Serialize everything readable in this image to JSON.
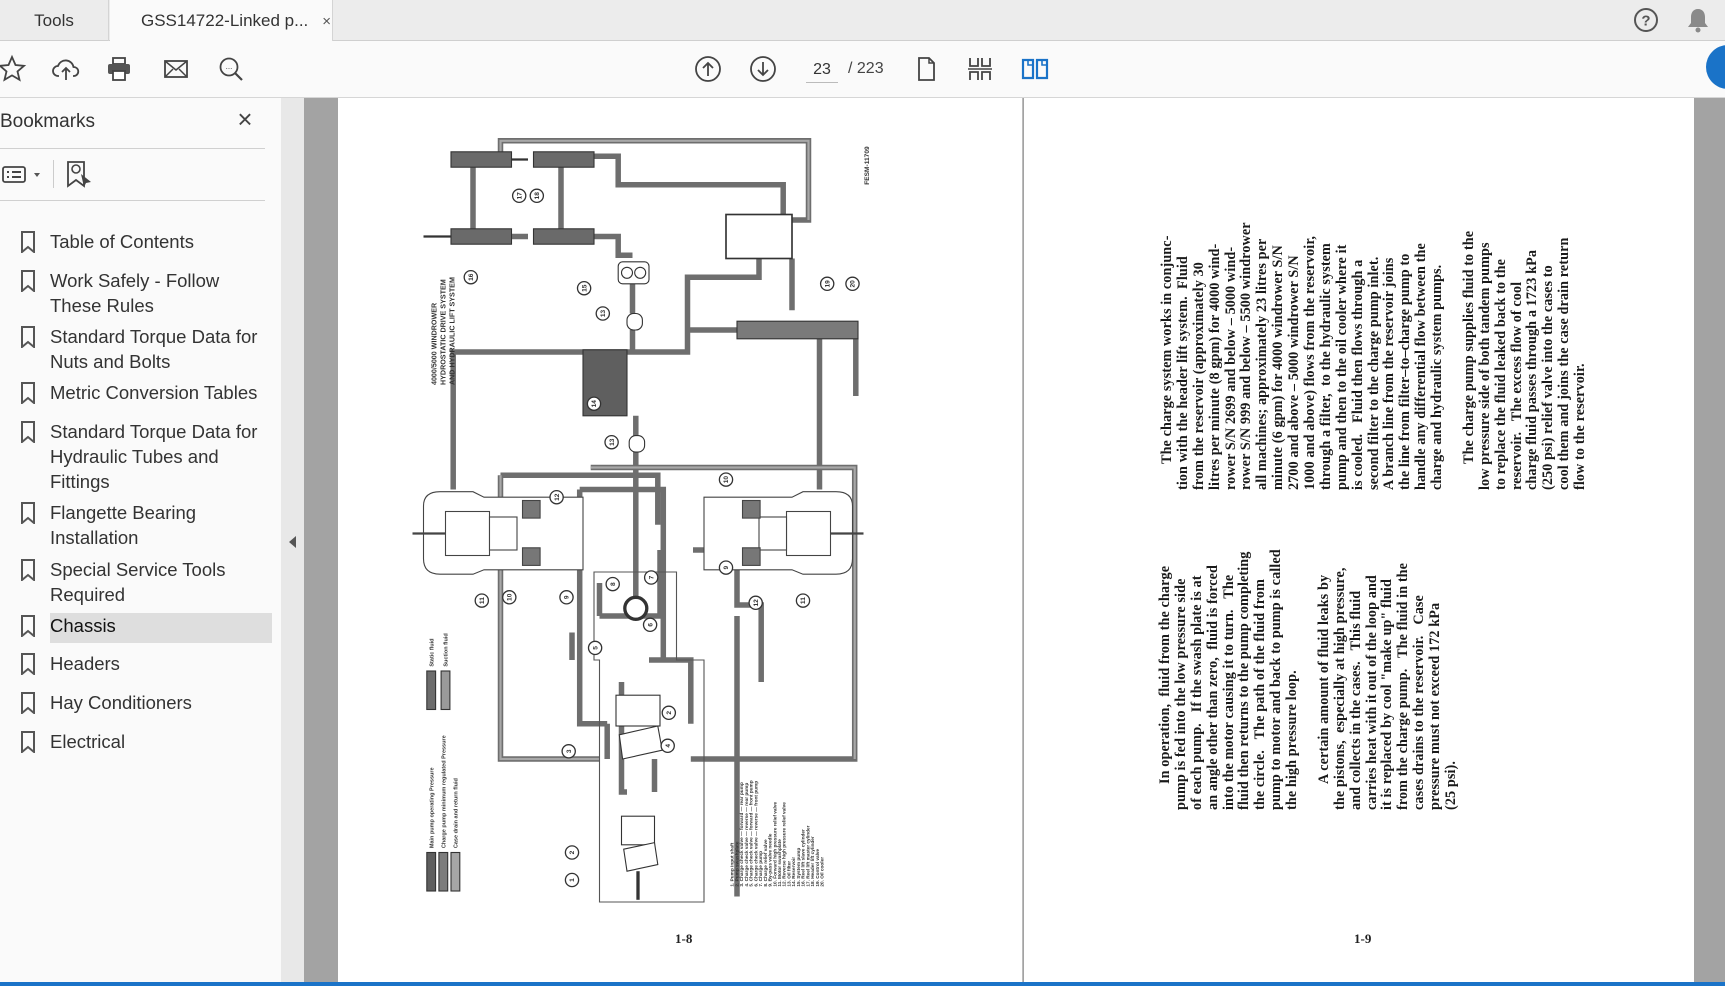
{
  "tabs": {
    "tools": "Tools",
    "document": "GSS14722-Linked p...",
    "close": "×"
  },
  "toolbar": {
    "current_page": "23",
    "total_pages": "/ 223",
    "icons": [
      "star-icon",
      "cloud-upload-icon",
      "print-icon",
      "mail-icon",
      "zoom-search-icon",
      "page-up-icon",
      "page-down-icon",
      "single-page-icon",
      "scroll-mode-icon",
      "two-page-icon",
      "help-icon",
      "bell-icon"
    ]
  },
  "accent": "#1a73c8",
  "sidebar": {
    "title": "Bookmarks",
    "close": "×",
    "items": [
      {
        "label": "Table of Contents"
      },
      {
        "label": "Work Safely - Follow These Rules"
      },
      {
        "label": "Standard Torque Data for Nuts and Bolts"
      },
      {
        "label": "Metric Conversion Tables"
      },
      {
        "label": "Standard Torque Data for Hydraulic Tubes and Fittings"
      },
      {
        "label": "Flangette Bearing Installation"
      },
      {
        "label": "Special Service Tools Required"
      },
      {
        "label": "Chassis",
        "active": true
      },
      {
        "label": "Headers"
      },
      {
        "label": "Hay Conditioners"
      },
      {
        "label": "Electrical"
      }
    ]
  },
  "diagram": {
    "title": [
      "4000/5000 WINDROWER",
      "HYDROSTATIC DRIVE SYSTEM",
      "AND HYDRAULIC LIFT SYSTEM"
    ],
    "figure_id": "FESM-11709",
    "legend_top": [
      "Static fluid",
      "Suction fluid"
    ],
    "legend_bottom": [
      "Main pump operating Pressure",
      "Charge pump minimum regulated Pressure",
      "Case drain and return fluid"
    ],
    "parts": [
      "1. Pump input shaft",
      "2. Pump swashplate",
      "3. Charge check valve — forward — rear pump",
      "4. Charge check valve — reverse — rear pump",
      "5. Charge check valve — forward — front pump",
      "6. Charge check valve — reverse — front pump",
      "7. Charge pump",
      "8. Charge relief valve",
      "9. By-pass valve needle",
      "10. Forward high pressure relief valve",
      "11. Motor swashplate",
      "12. Reverse high pressure relief valve",
      "13. Oil filter",
      "14. Reservoir",
      "15. System pump",
      "16. Reel lift slave cylinder",
      "17. Reel lift master cylinder",
      "18. Header lift cylinder",
      "19. Control valve",
      "20. Oil cooler"
    ],
    "callouts": [
      "17",
      "18",
      "16",
      "15",
      "19",
      "20",
      "13",
      "14",
      "13",
      "12",
      "10",
      "11",
      "10",
      "9",
      "7",
      "8",
      "6",
      "5",
      "12",
      "9",
      "11",
      "2",
      "3",
      "4",
      "2",
      "1"
    ]
  },
  "left_page": {
    "page_number": "1-8"
  },
  "right_page": {
    "page_number": "1-9",
    "block_upper": [
      {
        "t": "The charge system works in conjunc-",
        "indent": true
      },
      {
        "t": "tion with the header lift system.  Fluid"
      },
      {
        "t": "from the reservoir (approximately 30"
      },
      {
        "t": "litres per minute (8 gpm) for 4000 wind-"
      },
      {
        "t": "rower S/N 2699 and below – 5000 wind-"
      },
      {
        "t": "rower S/N 999 and below – 5500 windrower"
      },
      {
        "t": "all machines; approximately 23 litres per"
      },
      {
        "t": "minute (6 gpm) for 4000 windrower S/N"
      },
      {
        "t": "2700 and above – 5000 windrower S/N"
      },
      {
        "t": "1000 and above) flows from the reservoir,"
      },
      {
        "t": "through a filter,  to the hydraulic system"
      },
      {
        "t": "pump and then to the oil cooler where it"
      },
      {
        "t": "is cooled.   Fluid then flows through a"
      },
      {
        "t": "second filter to the charge pump inlet."
      },
      {
        "t": "A branch line from the reservoir joins"
      },
      {
        "t": "the line from filter–to–charge pump to"
      },
      {
        "t": "handle any differential flow between the"
      },
      {
        "t": "charge and hydraulic system pumps."
      },
      {
        "t": ""
      },
      {
        "t": "The charge pump supplies fluid to the",
        "indent": true
      },
      {
        "t": "low pressure side of both tandem pumps"
      },
      {
        "t": "to replace the fluid leaked back to the"
      },
      {
        "t": "reservoir.   The excess flow of cool"
      },
      {
        "t": "charge fluid passes through a 1723 kPa"
      },
      {
        "t": "(250 psi) relief valve into the cases to"
      },
      {
        "t": "cool them and joins the case drain return"
      },
      {
        "t": "flow to the reservoir."
      }
    ],
    "block_lower": [
      {
        "t": "In operation,  fluid from the charge",
        "indent": true
      },
      {
        "t": "pump is fed into the low pressure side"
      },
      {
        "t": "of each pump.   If the swash plate is at"
      },
      {
        "t": "an angle other than zero,  fluid is forced"
      },
      {
        "t": "into the motor causing it to turn.   The"
      },
      {
        "t": "fluid then returns to the pump completing"
      },
      {
        "t": "the circle.   The path of the fluid from"
      },
      {
        "t": "pump to motor and back to pump is called"
      },
      {
        "t": "the high pressure loop."
      },
      {
        "t": ""
      },
      {
        "t": "A certain amount of fluid leaks by",
        "indent": true
      },
      {
        "t": "the pistons,  especially at high pressure,"
      },
      {
        "t": "and collects in the cases.   This fluid"
      },
      {
        "t": "carries heat with it out of the loop and"
      },
      {
        "t": "it is replaced by cool \"make up\" fluid"
      },
      {
        "t": "from the charge pump.   The fluid in the"
      },
      {
        "t": "cases drains to the reservoir.   Case"
      },
      {
        "t": "pressure must not exceed 172 kPa"
      },
      {
        "t": "(25 psi)."
      }
    ]
  }
}
